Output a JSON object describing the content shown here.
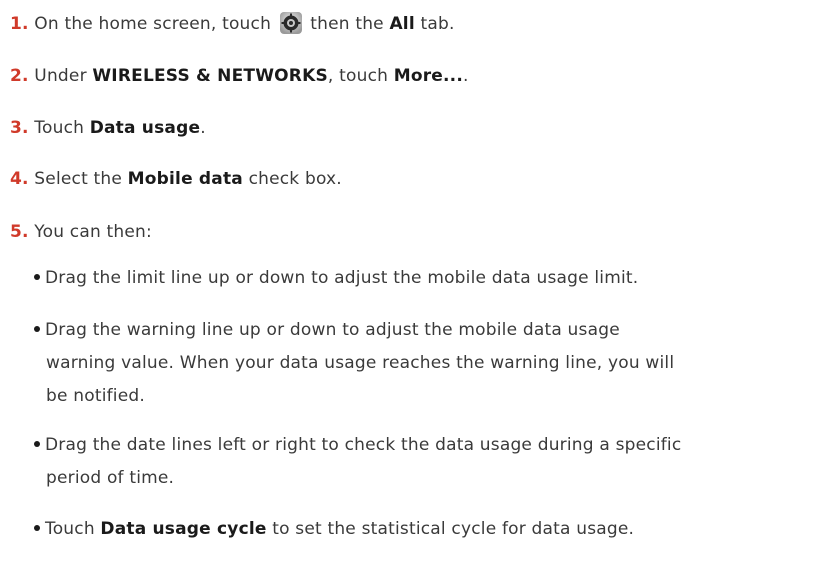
{
  "steps": [
    {
      "num": "1.",
      "parts": [
        "On the home screen, touch ",
        " then the ",
        "All",
        " tab."
      ]
    },
    {
      "num": "2.",
      "parts": [
        "Under ",
        "WIRELESS & NETWORKS",
        ", touch ",
        "More...",
        "."
      ]
    },
    {
      "num": "3.",
      "parts": [
        "Touch ",
        "Data usage",
        "."
      ]
    },
    {
      "num": "4.",
      "parts": [
        "Select the ",
        "Mobile data",
        " check box."
      ]
    },
    {
      "num": "5.",
      "parts": [
        "You can then:"
      ]
    }
  ],
  "bullets": [
    {
      "lines": [
        "Drag the limit line up or down to adjust the mobile data usage limit."
      ]
    },
    {
      "lines": [
        "Drag the warning line up or down to adjust the mobile data usage",
        "warning value. When your data usage reaches the warning line, you will",
        "be notified."
      ]
    },
    {
      "lines": [
        "Drag the date lines left or right to check the data usage during a specific",
        "period of time."
      ]
    },
    {
      "parts": [
        "Touch ",
        "Data usage cycle",
        " to set the statistical cycle for data usage."
      ]
    }
  ],
  "icons": {
    "settings": "settings-gear-icon"
  }
}
